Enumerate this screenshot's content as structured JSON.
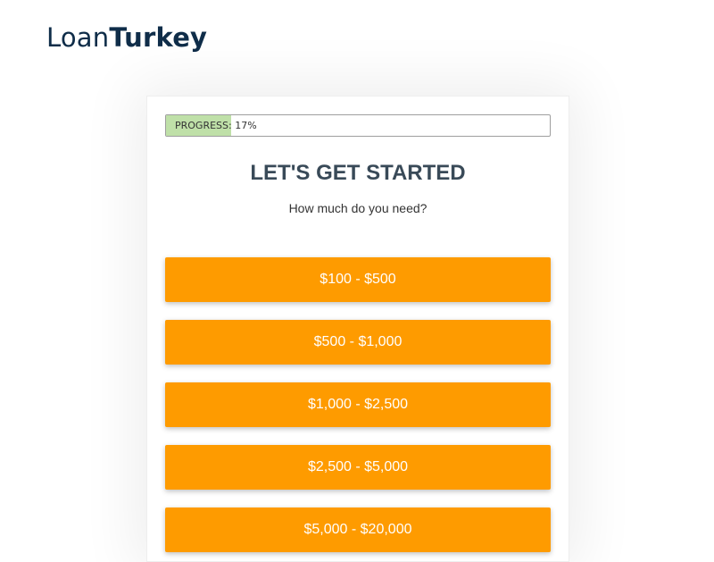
{
  "header": {
    "logo_part1": "Loan",
    "logo_part2": "Turkey"
  },
  "progress": {
    "label": "PROGRESS:",
    "value_text": "17%",
    "value": 17
  },
  "main": {
    "title": "LET'S GET STARTED",
    "question": "How much do you need?"
  },
  "options": [
    {
      "label": "$100 - $500"
    },
    {
      "label": "$500 - $1,000"
    },
    {
      "label": "$1,000 - $2,500"
    },
    {
      "label": "$2,500 - $5,000"
    },
    {
      "label": "$5,000 - $20,000"
    }
  ],
  "colors": {
    "accent": "#fe9b00",
    "brand": "#0f2d49",
    "progress_fill": "#bfe0a8",
    "title": "#394a58"
  }
}
